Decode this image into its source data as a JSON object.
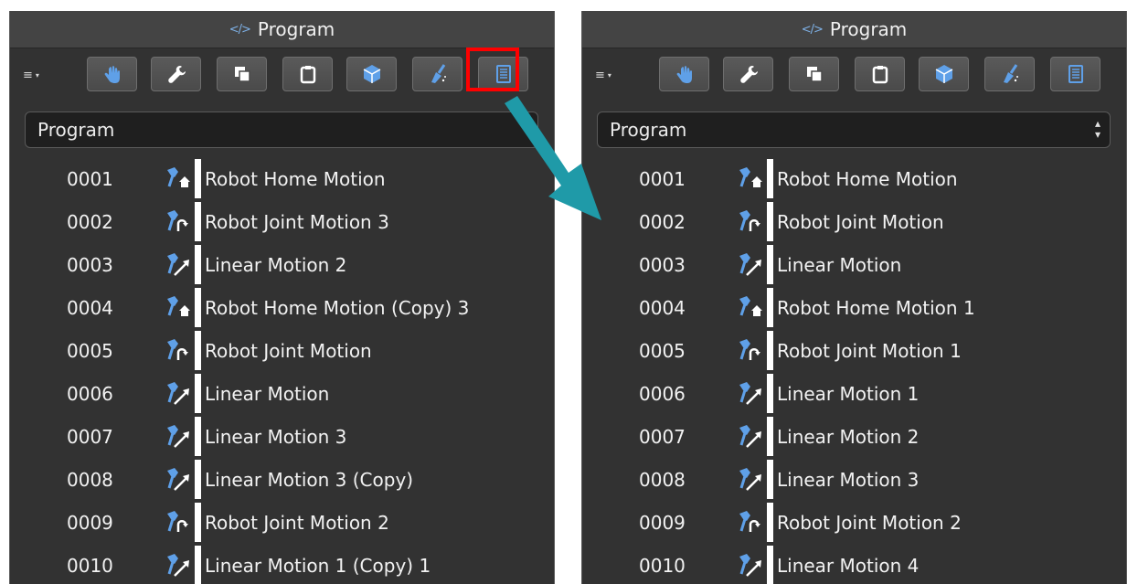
{
  "left_panel": {
    "title": "Program",
    "title_icon": "</>",
    "menu_icon": "≡",
    "menu_caret": "▾",
    "dropdown_value": "Program",
    "rows": [
      {
        "num": "0001",
        "icon": "robot-home-icon",
        "label": "Robot Home Motion"
      },
      {
        "num": "0002",
        "icon": "robot-joint-icon",
        "label": "Robot Joint Motion 3"
      },
      {
        "num": "0003",
        "icon": "linear-motion-icon",
        "label": "Linear Motion 2"
      },
      {
        "num": "0004",
        "icon": "robot-home-icon",
        "label": "Robot Home Motion (Copy) 3"
      },
      {
        "num": "0005",
        "icon": "robot-joint-icon",
        "label": "Robot Joint Motion"
      },
      {
        "num": "0006",
        "icon": "linear-motion-icon",
        "label": "Linear Motion"
      },
      {
        "num": "0007",
        "icon": "linear-motion-icon",
        "label": "Linear Motion 3"
      },
      {
        "num": "0008",
        "icon": "linear-motion-icon",
        "label": "Linear Motion 3 (Copy)"
      },
      {
        "num": "0009",
        "icon": "robot-joint-icon",
        "label": "Robot Joint Motion 2"
      },
      {
        "num": "0010",
        "icon": "linear-motion-icon",
        "label": "Linear Motion 1 (Copy) 1"
      }
    ]
  },
  "right_panel": {
    "title": "Program",
    "title_icon": "</>",
    "menu_icon": "≡",
    "menu_caret": "▾",
    "dropdown_value": "Program",
    "rows": [
      {
        "num": "0001",
        "icon": "robot-home-icon",
        "label": "Robot Home Motion"
      },
      {
        "num": "0002",
        "icon": "robot-joint-icon",
        "label": "Robot Joint Motion"
      },
      {
        "num": "0003",
        "icon": "linear-motion-icon",
        "label": "Linear Motion"
      },
      {
        "num": "0004",
        "icon": "robot-home-icon",
        "label": "Robot Home Motion 1"
      },
      {
        "num": "0005",
        "icon": "robot-joint-icon",
        "label": "Robot Joint Motion 1"
      },
      {
        "num": "0006",
        "icon": "linear-motion-icon",
        "label": "Linear Motion 1"
      },
      {
        "num": "0007",
        "icon": "linear-motion-icon",
        "label": "Linear Motion 2"
      },
      {
        "num": "0008",
        "icon": "linear-motion-icon",
        "label": "Linear Motion 3"
      },
      {
        "num": "0009",
        "icon": "robot-joint-icon",
        "label": "Robot Joint Motion 2"
      },
      {
        "num": "0010",
        "icon": "linear-motion-icon",
        "label": "Linear Motion 4"
      }
    ]
  },
  "toolbar_icons": [
    "hand-icon",
    "wrench-icon",
    "copy-icon",
    "clipboard-icon",
    "cube-icon",
    "broom-icon",
    "sort-list-icon"
  ],
  "highlighted_button": "sort-list-icon",
  "colors": {
    "panel_bg": "#323232",
    "title_bg": "#444444",
    "icon_blue": "#5fa0e8",
    "highlight": "#ff0000",
    "arrow": "#1f9aa8"
  }
}
